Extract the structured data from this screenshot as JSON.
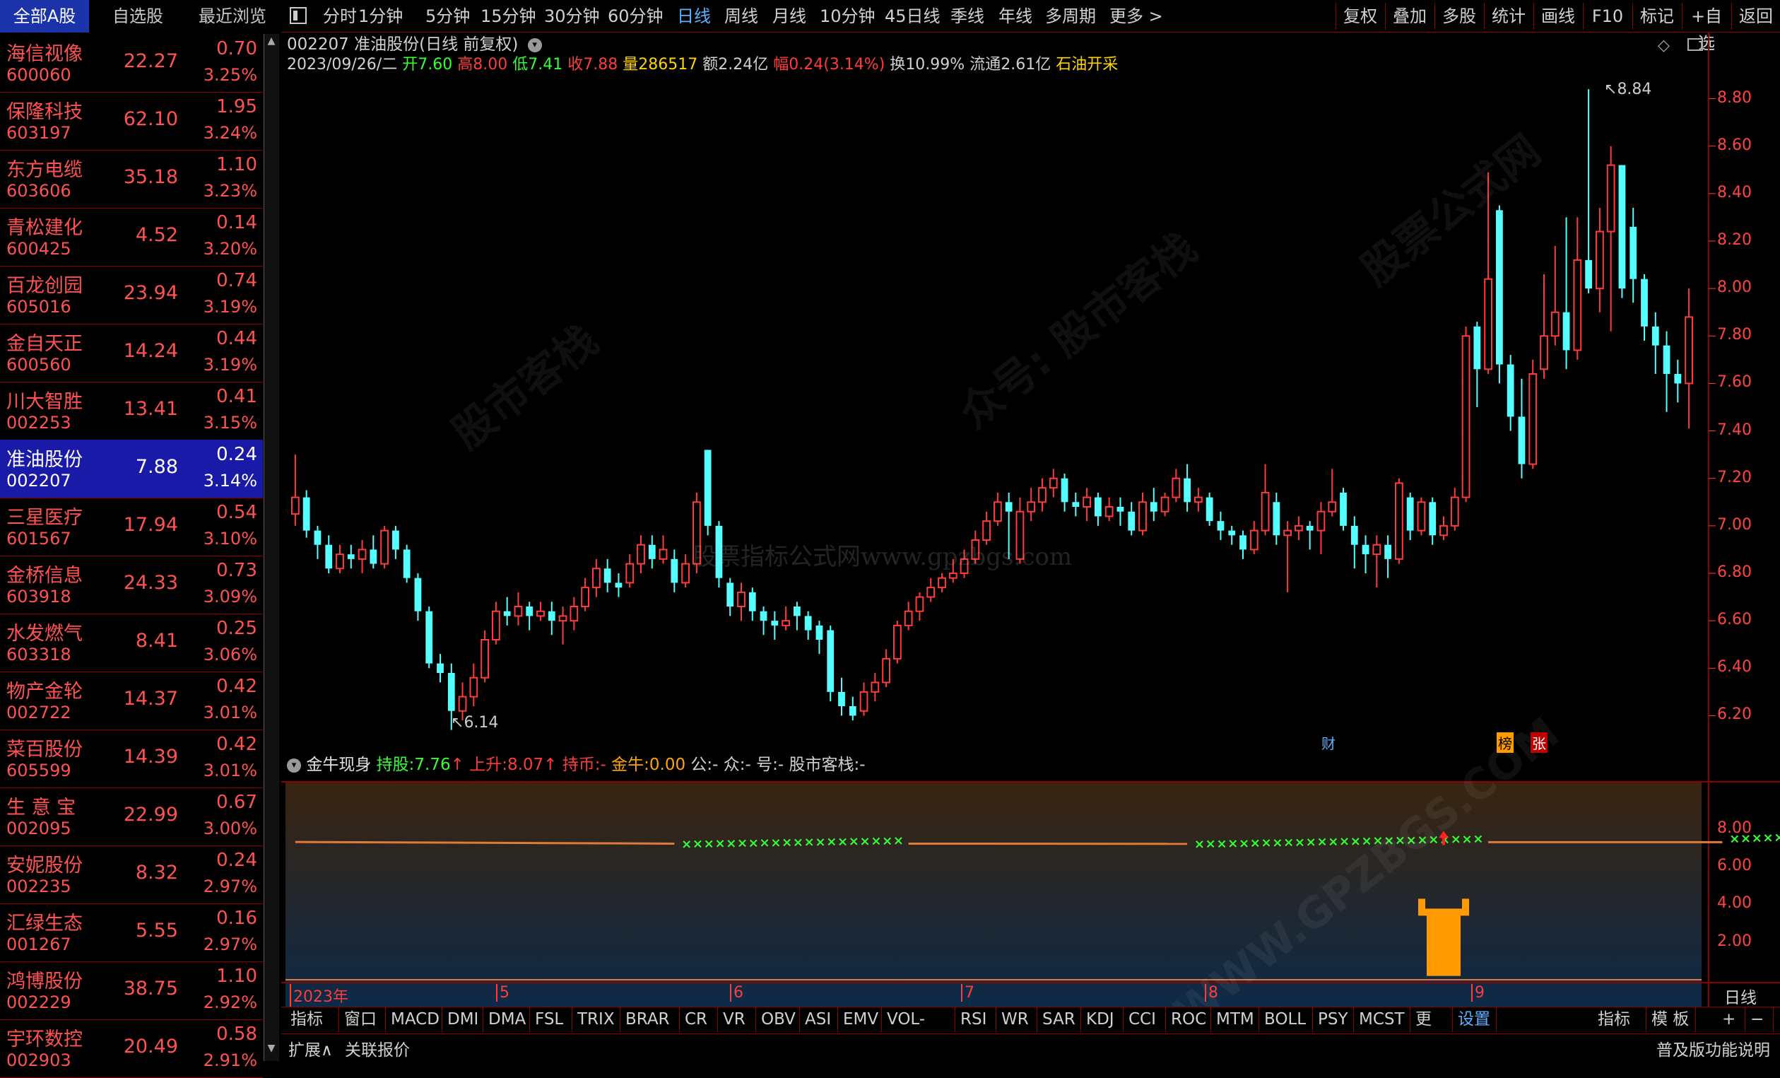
{
  "left_tabs": [
    "全部A股",
    "自选股",
    "最近浏览"
  ],
  "stocks": [
    {
      "name": "海信视像",
      "code": "600060",
      "price": "22.27",
      "change": "0.70",
      "pct": "3.25%"
    },
    {
      "name": "保隆科技",
      "code": "603197",
      "price": "62.10",
      "change": "1.95",
      "pct": "3.24%"
    },
    {
      "name": "东方电缆",
      "code": "603606",
      "price": "35.18",
      "change": "1.10",
      "pct": "3.23%"
    },
    {
      "name": "青松建化",
      "code": "600425",
      "price": "4.52",
      "change": "0.14",
      "pct": "3.20%"
    },
    {
      "name": "百龙创园",
      "code": "605016",
      "price": "23.94",
      "change": "0.74",
      "pct": "3.19%"
    },
    {
      "name": "金自天正",
      "code": "600560",
      "price": "14.24",
      "change": "0.44",
      "pct": "3.19%"
    },
    {
      "name": "川大智胜",
      "code": "002253",
      "price": "13.41",
      "change": "0.41",
      "pct": "3.15%"
    },
    {
      "name": "准油股份",
      "code": "002207",
      "price": "7.88",
      "change": "0.24",
      "pct": "3.14%"
    },
    {
      "name": "三星医疗",
      "code": "601567",
      "price": "17.94",
      "change": "0.54",
      "pct": "3.10%"
    },
    {
      "name": "金桥信息",
      "code": "603918",
      "price": "24.33",
      "change": "0.73",
      "pct": "3.09%"
    },
    {
      "name": "水发燃气",
      "code": "603318",
      "price": "8.41",
      "change": "0.25",
      "pct": "3.06%"
    },
    {
      "name": "物产金轮",
      "code": "002722",
      "price": "14.37",
      "change": "0.42",
      "pct": "3.01%"
    },
    {
      "name": "菜百股份",
      "code": "605599",
      "price": "14.39",
      "change": "0.42",
      "pct": "3.01%"
    },
    {
      "name": "生 意 宝",
      "code": "002095",
      "price": "22.99",
      "change": "0.67",
      "pct": "3.00%"
    },
    {
      "name": "安妮股份",
      "code": "002235",
      "price": "8.32",
      "change": "0.24",
      "pct": "2.97%"
    },
    {
      "name": "汇绿生态",
      "code": "001267",
      "price": "5.55",
      "change": "0.16",
      "pct": "2.97%"
    },
    {
      "name": "鸿博股份",
      "code": "002229",
      "price": "38.75",
      "change": "1.10",
      "pct": "2.92%"
    },
    {
      "name": "宇环数控",
      "code": "002903",
      "price": "20.49",
      "change": "0.58",
      "pct": "2.91%"
    }
  ],
  "selected_index": 7,
  "periods": [
    "分时",
    "1分钟",
    "5分钟",
    "15分钟",
    "30分钟",
    "60分钟",
    "日线",
    "周线",
    "月线",
    "10分钟",
    "45日线",
    "季线",
    "年线",
    "多周期",
    "更多 >"
  ],
  "active_period": "日线",
  "right_buttons": [
    "复权",
    "叠加",
    "多股",
    "统计",
    "画线",
    "F10",
    "标记",
    "+自选",
    "返回"
  ],
  "info": {
    "title": "002207 准油股份(日线 前复权)",
    "date": "2023/09/26/二",
    "open_label": "开",
    "open": "7.60",
    "high_label": "高",
    "high": "8.00",
    "low_label": "低",
    "low": "7.41",
    "close_label": "收",
    "close": "7.88",
    "vol_label": "量",
    "vol": "286517",
    "amt_label": "额",
    "amt": "2.24亿",
    "range_label": "幅",
    "range": "0.24(3.14%)",
    "turn_label": "换",
    "turn": "10.99%",
    "float_label": "流通",
    "float": "2.61亿",
    "industry": "石油开采"
  },
  "price_axis": [
    "8.80",
    "8.60",
    "8.40",
    "8.20",
    "8.00",
    "7.80",
    "7.60",
    "7.40",
    "7.20",
    "7.00",
    "6.80",
    "6.60",
    "6.40",
    "6.20"
  ],
  "annotations": {
    "high_mark": "8.84",
    "low_mark": "6.14",
    "tag_cai": "财",
    "tag_bang": "榜",
    "tag_zhang": "张"
  },
  "indicator": {
    "name": "金牛现身",
    "hold_label": "持股:",
    "hold": "7.76",
    "rise_label": "上升:",
    "rise": "8.07",
    "coin_label": "持币:",
    "coin": "-",
    "bull_label": "金牛:",
    "bull": "0.00",
    "g_label": "公:",
    "g": "-",
    "z_label": "众:",
    "z": "-",
    "h_label": "号:",
    "h": "-",
    "s_label": "股市客栈:",
    "s": "-"
  },
  "ind_axis": [
    "8.00",
    "6.00",
    "4.00",
    "2.00"
  ],
  "date_axis": [
    "2023年",
    "5",
    "6",
    "7",
    "8",
    "9"
  ],
  "date_axis_right": "日线",
  "bottom_tabs": [
    "指标A",
    "窗口",
    "MACD",
    "DMI",
    "DMA",
    "FSL",
    "TRIX",
    "BRAR",
    "CR",
    "VR",
    "OBV",
    "ASI",
    "EMV",
    "VOL-TDX",
    "RSI",
    "WR",
    "SAR",
    "KDJ",
    "CCI",
    "ROC",
    "MTM",
    "BOLL",
    "PSY",
    "MCST",
    "更多",
    "设置"
  ],
  "active_bottom": "设置",
  "bottom_right": [
    "指标B",
    "模 板",
    "+",
    "−"
  ],
  "status": {
    "expand": "扩展∧",
    "link": "关联报价",
    "help": "普及版功能说明"
  },
  "watermarks": [
    "股市客栈",
    "众号: 股市客栈",
    "WWW.GPZBGS.COM",
    "股票公式网"
  ],
  "center_wm": "股票指标公式网www.gpzbgs.com",
  "colors": {
    "up": "#ff3b3b",
    "down": "#54ffff",
    "grid": "#8b0000",
    "blue": "#5ab0ff",
    "yellow": "#ffd400",
    "green": "#33ff33"
  },
  "chart_data": {
    "type": "candlestick",
    "ylim": [
      6.1,
      8.9
    ],
    "candles": [
      [
        7.05,
        7.12,
        7.3,
        7.0
      ],
      [
        7.12,
        6.98,
        7.15,
        6.95
      ],
      [
        6.98,
        6.92,
        7.0,
        6.86
      ],
      [
        6.92,
        6.82,
        6.96,
        6.8
      ],
      [
        6.82,
        6.88,
        6.92,
        6.8
      ],
      [
        6.88,
        6.86,
        6.92,
        6.82
      ],
      [
        6.86,
        6.9,
        6.94,
        6.8
      ],
      [
        6.9,
        6.84,
        6.96,
        6.82
      ],
      [
        6.84,
        6.98,
        7.0,
        6.82
      ],
      [
        6.98,
        6.9,
        7.0,
        6.86
      ],
      [
        6.9,
        6.78,
        6.92,
        6.76
      ],
      [
        6.78,
        6.64,
        6.8,
        6.6
      ],
      [
        6.64,
        6.42,
        6.66,
        6.4
      ],
      [
        6.42,
        6.38,
        6.46,
        6.34
      ],
      [
        6.38,
        6.22,
        6.42,
        6.14
      ],
      [
        6.22,
        6.28,
        6.34,
        6.18
      ],
      [
        6.28,
        6.36,
        6.42,
        6.24
      ],
      [
        6.36,
        6.52,
        6.56,
        6.34
      ],
      [
        6.52,
        6.64,
        6.68,
        6.5
      ],
      [
        6.64,
        6.62,
        6.7,
        6.58
      ],
      [
        6.62,
        6.66,
        6.72,
        6.58
      ],
      [
        6.66,
        6.62,
        6.68,
        6.56
      ],
      [
        6.62,
        6.64,
        6.68,
        6.6
      ],
      [
        6.64,
        6.6,
        6.68,
        6.54
      ],
      [
        6.6,
        6.62,
        6.66,
        6.5
      ],
      [
        6.6,
        6.66,
        6.7,
        6.56
      ],
      [
        6.66,
        6.74,
        6.78,
        6.64
      ],
      [
        6.74,
        6.82,
        6.86,
        6.7
      ],
      [
        6.82,
        6.76,
        6.86,
        6.72
      ],
      [
        6.76,
        6.74,
        6.8,
        6.7
      ],
      [
        6.76,
        6.84,
        6.88,
        6.74
      ],
      [
        6.84,
        6.92,
        6.96,
        6.8
      ],
      [
        6.92,
        6.86,
        6.96,
        6.82
      ],
      [
        6.86,
        6.9,
        6.96,
        6.84
      ],
      [
        6.86,
        6.76,
        6.9,
        6.72
      ],
      [
        6.76,
        6.84,
        6.88,
        6.74
      ],
      [
        6.84,
        7.1,
        7.14,
        6.8
      ],
      [
        7.32,
        7.0,
        7.32,
        6.96
      ],
      [
        7.0,
        6.78,
        7.02,
        6.74
      ],
      [
        6.76,
        6.66,
        6.78,
        6.62
      ],
      [
        6.66,
        6.72,
        6.76,
        6.6
      ],
      [
        6.72,
        6.64,
        6.74,
        6.6
      ],
      [
        6.64,
        6.6,
        6.66,
        6.54
      ],
      [
        6.6,
        6.58,
        6.64,
        6.52
      ],
      [
        6.58,
        6.6,
        6.66,
        6.56
      ],
      [
        6.66,
        6.62,
        6.68,
        6.56
      ],
      [
        6.62,
        6.56,
        6.64,
        6.52
      ],
      [
        6.58,
        6.52,
        6.6,
        6.46
      ],
      [
        6.56,
        6.3,
        6.58,
        6.26
      ],
      [
        6.3,
        6.24,
        6.36,
        6.2
      ],
      [
        6.24,
        6.2,
        6.28,
        6.18
      ],
      [
        6.22,
        6.3,
        6.34,
        6.2
      ],
      [
        6.3,
        6.34,
        6.38,
        6.26
      ],
      [
        6.34,
        6.44,
        6.48,
        6.32
      ],
      [
        6.44,
        6.58,
        6.6,
        6.42
      ],
      [
        6.58,
        6.64,
        6.68,
        6.56
      ],
      [
        6.64,
        6.7,
        6.72,
        6.6
      ],
      [
        6.7,
        6.74,
        6.78,
        6.68
      ],
      [
        6.74,
        6.78,
        6.8,
        6.72
      ],
      [
        6.78,
        6.8,
        6.86,
        6.76
      ],
      [
        6.8,
        6.86,
        6.9,
        6.78
      ],
      [
        6.86,
        6.94,
        6.98,
        6.84
      ],
      [
        6.94,
        7.02,
        7.06,
        6.92
      ],
      [
        7.02,
        7.1,
        7.14,
        7.0
      ],
      [
        7.1,
        7.06,
        7.14,
        6.86
      ],
      [
        6.86,
        7.06,
        7.12,
        6.84
      ],
      [
        7.06,
        7.1,
        7.16,
        7.02
      ],
      [
        7.1,
        7.16,
        7.2,
        7.06
      ],
      [
        7.16,
        7.2,
        7.24,
        7.12
      ],
      [
        7.2,
        7.1,
        7.22,
        7.06
      ],
      [
        7.1,
        7.08,
        7.14,
        7.04
      ],
      [
        7.08,
        7.12,
        7.16,
        7.02
      ],
      [
        7.12,
        7.04,
        7.14,
        7.0
      ],
      [
        7.04,
        7.08,
        7.12,
        7.02
      ],
      [
        7.08,
        7.06,
        7.12,
        7.0
      ],
      [
        7.06,
        6.98,
        7.1,
        6.96
      ],
      [
        6.98,
        7.1,
        7.14,
        6.96
      ],
      [
        7.1,
        7.06,
        7.16,
        7.02
      ],
      [
        7.06,
        7.12,
        7.14,
        7.04
      ],
      [
        7.12,
        7.2,
        7.24,
        7.1
      ],
      [
        7.2,
        7.1,
        7.26,
        7.06
      ],
      [
        7.1,
        7.12,
        7.16,
        7.06
      ],
      [
        7.12,
        7.02,
        7.14,
        7.0
      ],
      [
        7.02,
        6.98,
        7.06,
        6.94
      ],
      [
        6.98,
        6.96,
        7.0,
        6.92
      ],
      [
        6.96,
        6.9,
        6.98,
        6.86
      ],
      [
        6.9,
        6.98,
        7.02,
        6.88
      ],
      [
        6.98,
        7.14,
        7.26,
        6.96
      ],
      [
        7.1,
        6.96,
        7.14,
        6.92
      ],
      [
        6.96,
        6.98,
        7.02,
        6.72
      ],
      [
        6.98,
        7.0,
        7.04,
        6.94
      ],
      [
        7.0,
        6.98,
        7.02,
        6.9
      ],
      [
        6.98,
        7.06,
        7.1,
        6.88
      ],
      [
        7.06,
        7.1,
        7.24,
        7.04
      ],
      [
        7.14,
        7.0,
        7.16,
        6.98
      ],
      [
        7.0,
        6.92,
        7.04,
        6.82
      ],
      [
        6.92,
        6.88,
        6.96,
        6.8
      ],
      [
        6.88,
        6.92,
        6.96,
        6.74
      ],
      [
        6.92,
        6.86,
        6.96,
        6.78
      ],
      [
        6.86,
        7.18,
        7.2,
        6.84
      ],
      [
        7.12,
        6.98,
        7.14,
        6.94
      ],
      [
        6.98,
        7.1,
        7.12,
        6.96
      ],
      [
        7.1,
        6.96,
        7.12,
        6.92
      ],
      [
        6.96,
        7.0,
        7.04,
        6.94
      ],
      [
        7.0,
        7.12,
        7.16,
        6.98
      ],
      [
        7.12,
        7.8,
        7.84,
        7.1
      ],
      [
        7.84,
        7.66,
        7.86,
        7.5
      ],
      [
        7.66,
        8.04,
        8.49,
        7.64
      ],
      [
        8.33,
        7.68,
        8.35,
        7.6
      ],
      [
        7.68,
        7.46,
        7.72,
        7.4
      ],
      [
        7.46,
        7.26,
        7.62,
        7.2
      ],
      [
        7.26,
        7.64,
        7.7,
        7.24
      ],
      [
        7.66,
        7.8,
        8.06,
        7.62
      ],
      [
        7.8,
        7.9,
        8.18,
        7.76
      ],
      [
        7.9,
        7.74,
        8.3,
        7.66
      ],
      [
        7.74,
        8.12,
        8.3,
        7.7
      ],
      [
        8.12,
        8.0,
        8.84,
        7.98
      ],
      [
        8.0,
        8.24,
        8.34,
        7.9
      ],
      [
        8.24,
        8.52,
        8.6,
        7.82
      ],
      [
        8.52,
        8.0,
        8.28,
        7.96
      ],
      [
        8.26,
        8.04,
        8.34,
        7.94
      ],
      [
        8.04,
        7.84,
        8.06,
        7.78
      ],
      [
        7.84,
        7.76,
        7.9,
        7.64
      ],
      [
        7.76,
        7.64,
        7.82,
        7.48
      ],
      [
        7.64,
        7.6,
        7.7,
        7.52
      ],
      [
        7.6,
        7.88,
        8.0,
        7.41
      ]
    ],
    "hold_segments": [
      [
        0,
        34,
        7.31,
        7.22
      ],
      [
        55,
        80,
        7.22,
        7.21
      ],
      [
        107,
        128,
        7.3,
        7.3
      ]
    ],
    "rise_segments": [
      [
        35,
        54,
        7.2,
        7.38
      ],
      [
        81,
        106,
        7.2,
        7.48
      ],
      [
        129,
        152,
        7.48,
        7.88
      ]
    ],
    "bull_signal_index": 103,
    "bull_value": 4.3
  }
}
